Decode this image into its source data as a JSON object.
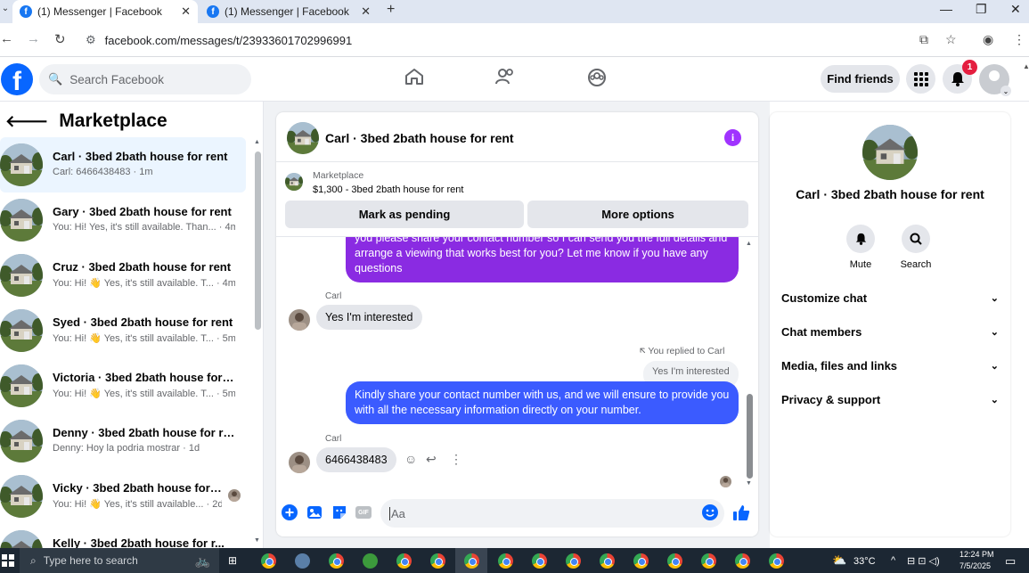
{
  "browser": {
    "tabs": [
      {
        "title": "(1) Messenger | Facebook",
        "active": true
      },
      {
        "title": "(1) Messenger | Facebook",
        "active": false
      }
    ],
    "url": "facebook.com/messages/t/23933601702996991"
  },
  "header": {
    "search_placeholder": "Search Facebook",
    "find_friends": "Find friends",
    "notification_count": "1"
  },
  "sidebar": {
    "title": "Marketplace",
    "conversations": [
      {
        "name": "Carl · 3bed 2bath house for rent",
        "preview": "Carl: 6466438483 · 1m",
        "selected": true
      },
      {
        "name": "Gary · 3bed 2bath house for rent",
        "preview": "You: Hi! Yes, it's still available. Than... · 4m"
      },
      {
        "name": "Cruz · 3bed 2bath house for rent",
        "preview": "You: Hi! 👋 Yes, it's still available. T... · 4m"
      },
      {
        "name": "Syed · 3bed 2bath house for rent",
        "preview": "You: Hi! 👋 Yes, it's still available. T... · 5m"
      },
      {
        "name": "Victoria · 3bed 2bath house for r...",
        "preview": "You: Hi! 👋 Yes, it's still available. T... · 5m"
      },
      {
        "name": "Denny · 3bed 2bath house for re...",
        "preview": "Denny: Hoy la podria mostrar · 1d"
      },
      {
        "name": "Vicky · 3bed 2bath house for r...",
        "preview": "You: Hi! 👋 Yes, it's still available... · 2d"
      },
      {
        "name": "Kelly · 3bed 2bath house for r...",
        "preview": ""
      }
    ]
  },
  "chat": {
    "title": "Carl · 3bed 2bath house for rent",
    "listing_label": "Marketplace",
    "listing_detail": "$1,300 - 3bed 2bath house for rent",
    "mark_pending": "Mark as pending",
    "more_options": "More options",
    "messages": {
      "out1": "you please share your contact number so I can send you the full details and arrange a viewing that works best for you? Let me know if you have any questions",
      "sender1": "Carl",
      "in1": "Yes I'm interested",
      "replied_label": "You replied to Carl",
      "reply_quote": "Yes I'm interested",
      "out2": "Kindly share your contact number with us, and we will ensure to provide you with all the necessary information directly on your number.",
      "sender2": "Carl",
      "in2": "6466438483"
    },
    "composer_placeholder": "Aa",
    "gif_label": "GIF"
  },
  "info_panel": {
    "name": "Carl · 3bed 2bath house for rent",
    "actions": [
      {
        "label": "Mute",
        "icon": "bell-icon"
      },
      {
        "label": "Search",
        "icon": "search-icon"
      }
    ],
    "sections": [
      "Customize chat",
      "Chat members",
      "Media, files and links",
      "Privacy & support"
    ]
  },
  "taskbar": {
    "search_placeholder": "Type here to search",
    "temperature": "33°C",
    "time": "12:24 PM",
    "date": "7/5/2025"
  },
  "colors": {
    "fb_blue": "#0866ff",
    "outgoing_purple": "#8a2be2",
    "outgoing_blue": "#3b5bff",
    "info_purple": "#a033ff",
    "notif_red": "#e41e3f"
  }
}
